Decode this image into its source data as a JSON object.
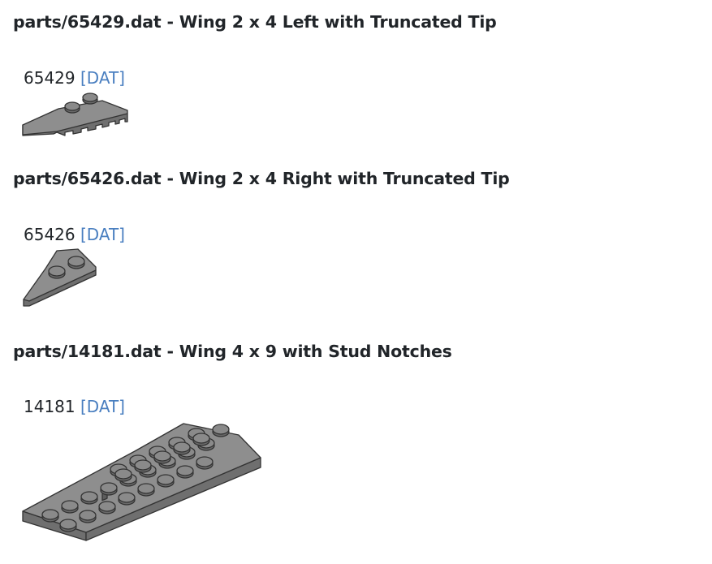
{
  "parts": [
    {
      "title": "parts/65429.dat - Wing 2 x 4 Left with Truncated Tip",
      "number": "65429",
      "link_label": "[DAT]",
      "image_icon": "wing-left-part-icon"
    },
    {
      "title": "parts/65426.dat - Wing 2 x 4 Right with Truncated Tip",
      "number": "65426",
      "link_label": "[DAT]",
      "image_icon": "wing-right-part-icon"
    },
    {
      "title": "parts/14181.dat - Wing 4 x 9 with Stud Notches",
      "number": "14181",
      "link_label": "[DAT]",
      "image_icon": "wing-4x9-part-icon"
    }
  ],
  "colors": {
    "text": "#212529",
    "link": "#4a7fc0",
    "part_gray": "#8e8e8e"
  }
}
